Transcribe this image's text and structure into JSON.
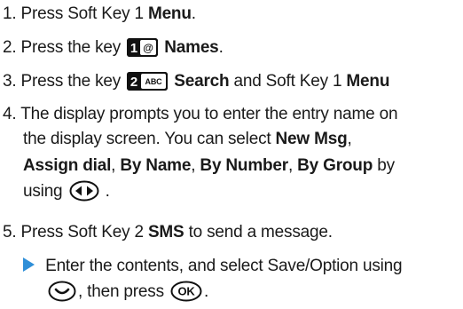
{
  "steps": [
    {
      "number": "1.",
      "pre": "Press Soft Key 1 ",
      "bold": "Menu",
      "post": "."
    },
    {
      "number": "2.",
      "pre": "Press the key ",
      "key_label": "1",
      "key_symbol": "@",
      "bold": "Names",
      "post": "."
    },
    {
      "number": "3.",
      "pre": "Press the key ",
      "key_label": "2",
      "key_symbol": "ABC",
      "bold": "Search",
      "mid": " and Soft Key 1 ",
      "bold2": "Menu"
    },
    {
      "number": "4.",
      "line1": "The display prompts you to enter the entry name on",
      "line2": "the display screen. You can select ",
      "line2_bold": "New Msg",
      "line2_post": ",",
      "line3_bold1": "Assign dial",
      "sep1": ", ",
      "line3_bold2": "By Name",
      "sep2": ", ",
      "line3_bold3": "By Number",
      "sep3": ", ",
      "line3_bold4": "By Group",
      "line3_post": " by",
      "line4_pre": "using ",
      "line4_post": "."
    },
    {
      "number": "5.",
      "pre": "Press Soft Key 2 ",
      "bold": "SMS",
      "post": " to send a message."
    }
  ],
  "substep": {
    "line1": "Enter the contents, and select  Save/Option using",
    "line2": ", then press ",
    "ok_label": "OK",
    "line2_post": "."
  },
  "icons": {
    "nav": "left-right-navigation-key-icon",
    "down": "down-navigation-key-icon",
    "ok": "ok-key-icon",
    "arrow": "blue-triangle-bullet-icon"
  },
  "colors": {
    "text": "#1a1a1a",
    "key": "#111111",
    "accent": "#2f8fd8"
  }
}
